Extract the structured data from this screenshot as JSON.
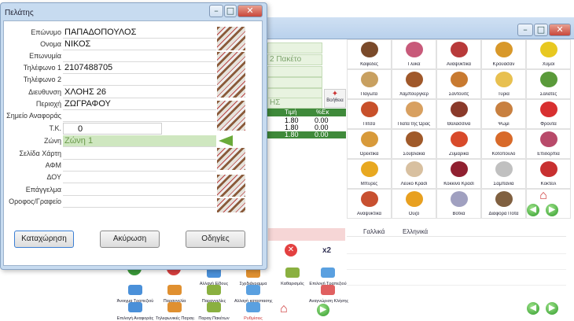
{
  "dialog": {
    "title": "Πελάτης",
    "fields": [
      {
        "label": "Επώνυμο",
        "value": "ΠΑΠΑΔΟΠΟΥΛΟΣ"
      },
      {
        "label": "Ονομα",
        "value": "ΝΙΚΟΣ"
      },
      {
        "label": "Επωνυμία",
        "value": ""
      },
      {
        "label": "Τηλέφωνο 1",
        "value": "2107488705"
      },
      {
        "label": "Τηλέφωνο 2",
        "value": ""
      },
      {
        "label": "Διευθυνση",
        "value": "ΧΛΟΗΣ 26"
      },
      {
        "label": "Περιοχή",
        "value": "ΖΩΓΡΑΦΟΥ"
      },
      {
        "label": "Σημείο Αναφοράς",
        "value": ""
      },
      {
        "label": "Τ.Κ.",
        "value": "0"
      },
      {
        "label": "Ζώνη",
        "value": "Ζώνη 1"
      },
      {
        "label": "Σελίδα Χάρτη",
        "value": ""
      },
      {
        "label": "ΑΦΜ",
        "value": ""
      },
      {
        "label": "ΔΟΥ",
        "value": ""
      },
      {
        "label": "Επάγγελμα",
        "value": ""
      },
      {
        "label": "Οροφος/Γραφείο",
        "value": ""
      }
    ],
    "buttons": {
      "save": "Καταχώρηση",
      "cancel": "Ακύρωση",
      "directions": "Οδηγίες"
    }
  },
  "window_controls": {
    "minimize": "–",
    "maximize": "□",
    "close": "✕"
  },
  "background": {
    "packet_label": "2 Πακέτο",
    "field_hs": "ΗΣ",
    "help_label": "Βοήθεια",
    "table_headers": [
      "Τιμή",
      "%Εκ"
    ],
    "table_rows": [
      [
        "1.80",
        "0.00"
      ],
      [
        "1.80",
        "0.00"
      ],
      [
        "1.80",
        "0.00"
      ]
    ],
    "x2_label": "x2"
  },
  "categories": [
    [
      "Καφέδες",
      "Γλυκά",
      "Αναψυκτικά",
      "Κρουασάν",
      "Χυμοί"
    ],
    [
      "Παγωτά",
      "Χάμπουργκερ",
      "Σάντουιτς",
      "Τυριά",
      "Σαλάτες"
    ],
    [
      "Πίτσα",
      "Πιάτα της Ώρας",
      "Θαλασσινά",
      "Ψωμί",
      "Φρούτα"
    ],
    [
      "Ορεκτικά",
      "Σουβλάκια",
      "Ζυμαρικά",
      "Κοτόπουλο",
      "Επιδόρπια"
    ],
    [
      "Μπύρες",
      "Λευκό Κρασί",
      "Κόκκινο Κρασί",
      "Σαμπάνια",
      "Κοκτέιλ"
    ],
    [
      "Αναψυκτικά",
      "Ούζο",
      "Βότκα",
      "Διάφορα Ποτά",
      ""
    ]
  ],
  "languages": [
    "Γαλλικά",
    "Ελληνικά"
  ],
  "toolbar": {
    "row1": [
      "Αλλαγή Είδους",
      "Σχεδιάγραμμα",
      "Καθαρισμός",
      "Επιλογή Τραπεζιού"
    ],
    "row2": [
      "Άνοιγμα Τραπεζιού",
      "Παραγγελία",
      "Παραγγελίες",
      "Αλλαγή καταστασης",
      "Αναγνώριση Κλήσης"
    ],
    "row3": [
      "Επιλογή Αναφοράς",
      "Τηλεφωνικές Παραγ.",
      "Παραγ.Πακέτων",
      "Ρυθμίσεις"
    ]
  },
  "nav": {
    "prev": "◀",
    "next": "▶"
  }
}
